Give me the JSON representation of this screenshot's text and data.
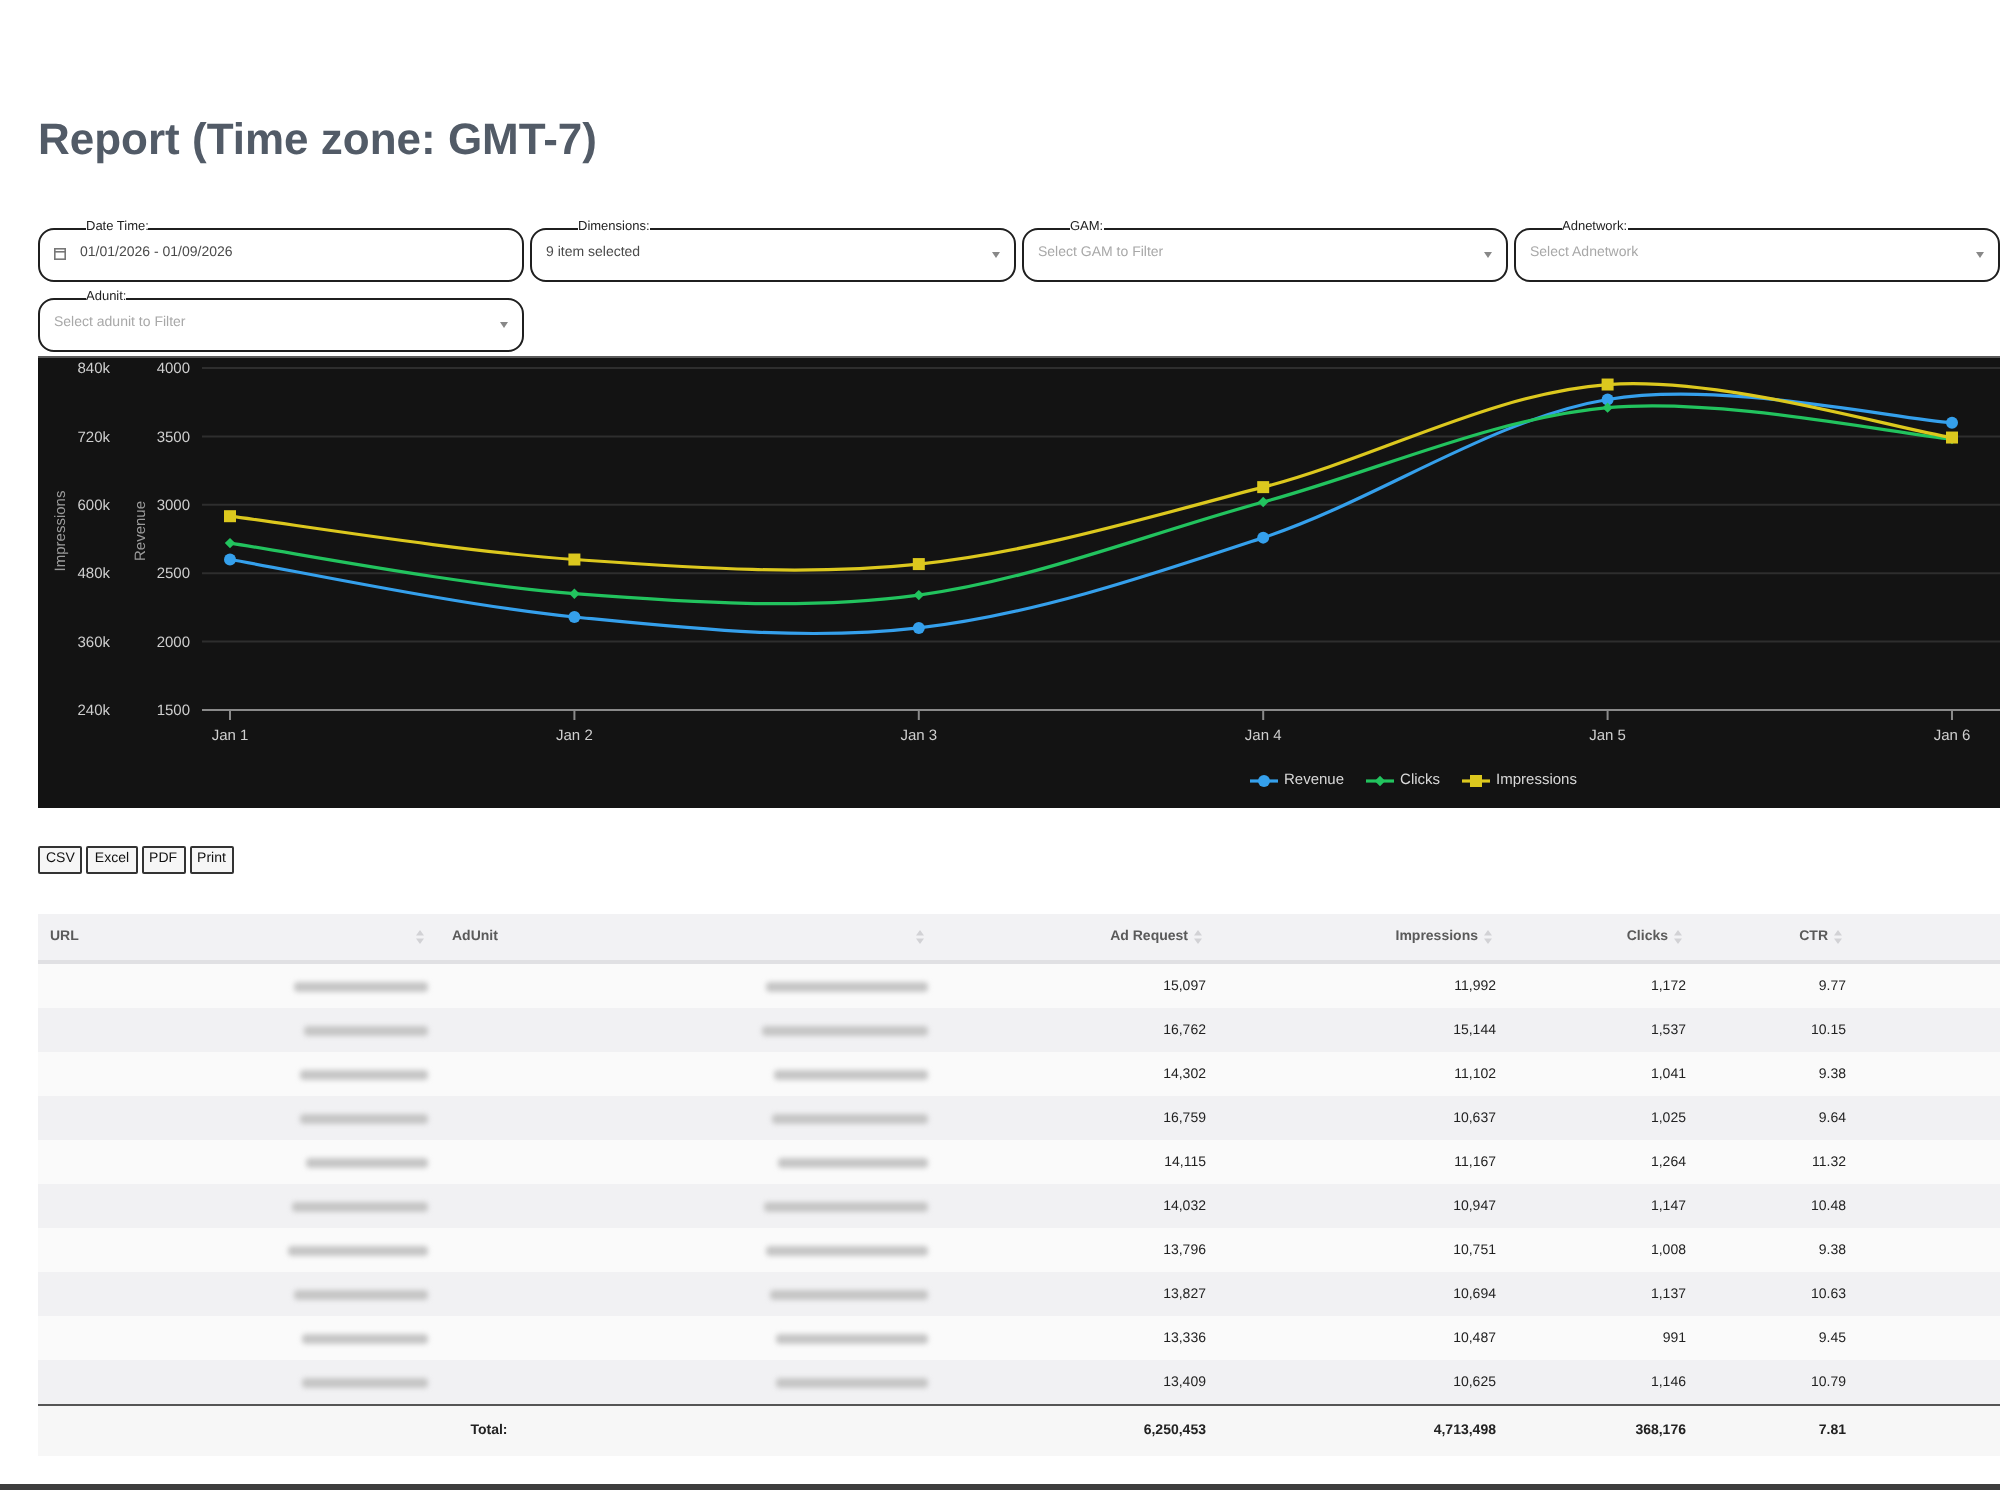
{
  "title": "Report (Time zone: GMT-7)",
  "filters": [
    {
      "label": "Date Time:",
      "kind": "date",
      "value": "01/01/2026 - 01/09/2026"
    },
    {
      "label": "Dimensions:",
      "kind": "select",
      "value": "9 item selected"
    },
    {
      "label": "GAM:",
      "kind": "select",
      "placeholder": "Select GAM to Filter"
    },
    {
      "label": "Adnetwork:",
      "kind": "select",
      "placeholder": "Select Adnetwork"
    },
    {
      "label": "Adunit:",
      "kind": "select",
      "placeholder": "Select adunit to Filter"
    }
  ],
  "chart": {
    "chart_data": {
      "type": "line",
      "grid": true,
      "legend": "bottom",
      "categories": [
        "Jan 1",
        "Jan 2",
        "Jan 3",
        "Jan 4",
        "Jan 5",
        "Jan 6"
      ],
      "ylabel": "Revenue",
      "ylim": [
        1500,
        4000
      ],
      "yticks": [
        1500,
        2000,
        2500,
        3000,
        3500,
        4000
      ],
      "y2label": "Impressions",
      "y2lim": [
        240000,
        840000
      ],
      "y2ticks": [
        {
          "value": 240000,
          "label": "240k"
        },
        {
          "value": 360000,
          "label": "360k"
        },
        {
          "value": 480000,
          "label": "480k"
        },
        {
          "value": 600000,
          "label": "600k"
        },
        {
          "value": 720000,
          "label": "720k"
        },
        {
          "value": 840000,
          "label": "840k"
        }
      ],
      "series": [
        {
          "name": "Revenue",
          "color": "#35a0ec",
          "marker": "circle",
          "axis": "y",
          "values": [
            2600,
            2180,
            2100,
            2760,
            3770,
            3600
          ]
        },
        {
          "name": "Clicks",
          "color": "#22c35e",
          "marker": "diamond",
          "axis": "y",
          "values": [
            2720,
            2350,
            2340,
            3020,
            3710,
            3480
          ]
        },
        {
          "name": "Impressions",
          "color": "#dcc81e",
          "marker": "square",
          "axis": "y2",
          "values": [
            580000,
            504000,
            496000,
            631000,
            811000,
            718000
          ]
        }
      ]
    }
  },
  "export_buttons": [
    "CSV",
    "Excel",
    "PDF",
    "Print"
  ],
  "table": {
    "columns": [
      {
        "label": "URL",
        "kind": "blurred"
      },
      {
        "label": "AdUnit",
        "kind": "blurred"
      },
      {
        "label": "Ad Request",
        "kind": "number"
      },
      {
        "label": "Impressions",
        "kind": "number"
      },
      {
        "label": "Clicks",
        "kind": "number"
      },
      {
        "label": "CTR",
        "kind": "number"
      }
    ],
    "rows": [
      {
        "values": [
          "15,097",
          "11,992",
          "1,172",
          "9.77"
        ]
      },
      {
        "values": [
          "16,762",
          "15,144",
          "1,537",
          "10.15"
        ]
      },
      {
        "values": [
          "14,302",
          "11,102",
          "1,041",
          "9.38"
        ]
      },
      {
        "values": [
          "16,759",
          "10,637",
          "1,025",
          "9.64"
        ]
      },
      {
        "values": [
          "14,115",
          "11,167",
          "1,264",
          "11.32"
        ]
      },
      {
        "values": [
          "14,032",
          "10,947",
          "1,147",
          "10.48"
        ]
      },
      {
        "values": [
          "13,796",
          "10,751",
          "1,008",
          "9.38"
        ]
      },
      {
        "values": [
          "13,827",
          "10,694",
          "1,137",
          "10.63"
        ]
      },
      {
        "values": [
          "13,336",
          "10,487",
          "991",
          "9.45"
        ]
      },
      {
        "values": [
          "13,409",
          "10,625",
          "1,146",
          "10.79"
        ]
      }
    ],
    "total": {
      "label": "Total:",
      "values": [
        "6,250,453",
        "4,713,498",
        "368,176",
        "7.81"
      ]
    }
  }
}
